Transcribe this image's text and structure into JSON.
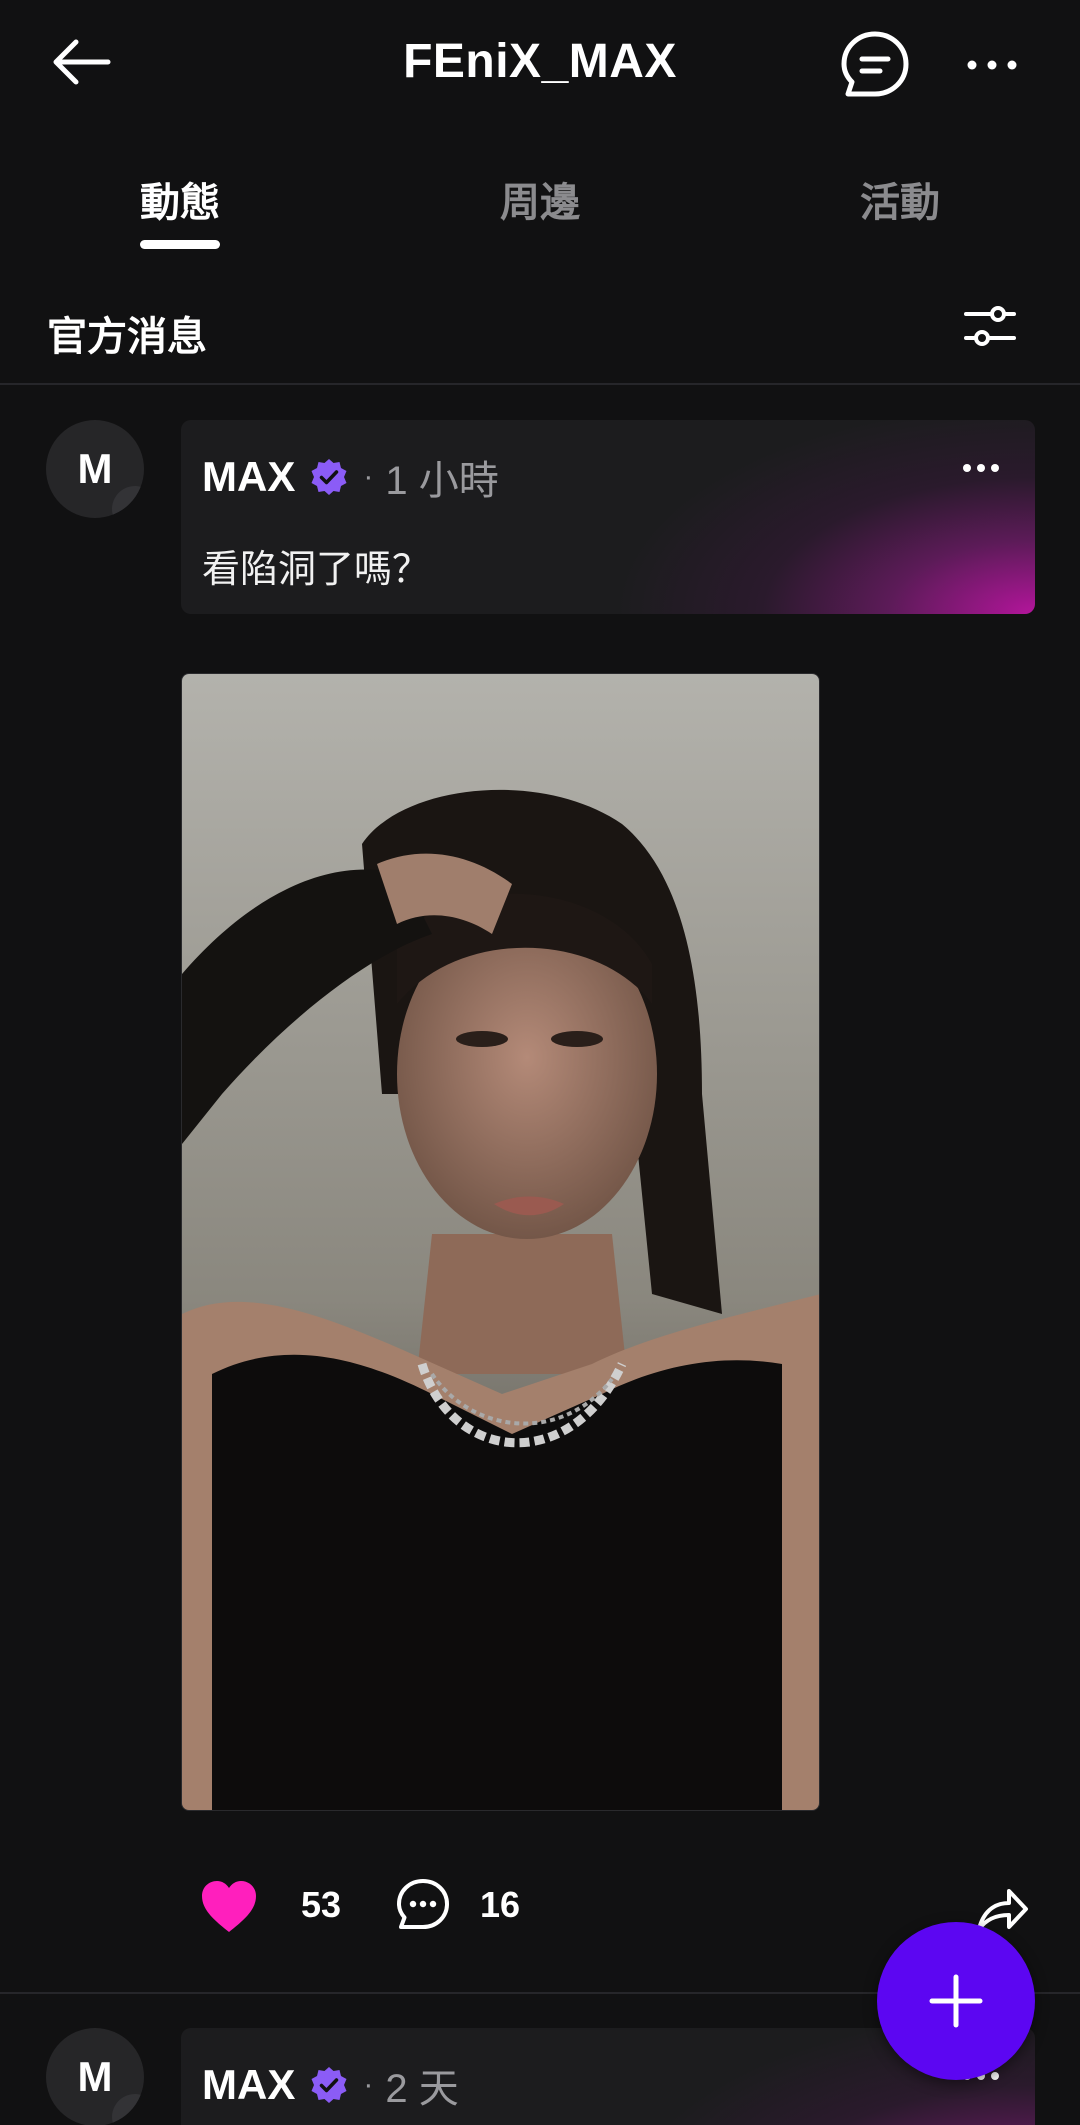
{
  "header": {
    "title": "FEniX_MAX",
    "back_icon": "back-arrow-icon",
    "chat_icon": "chat-bubble-icon",
    "more_icon": "more-horizontal-icon"
  },
  "tabs": [
    {
      "label": "動態",
      "active": true
    },
    {
      "label": "周邊",
      "active": false
    },
    {
      "label": "活動",
      "active": false
    }
  ],
  "section": {
    "title": "官方消息",
    "filter_icon": "sliders-icon"
  },
  "posts": [
    {
      "avatar_letter": "M",
      "author": "MAX",
      "verified": true,
      "separator": "·",
      "time": "1 小時",
      "text": "看陷洞了嗎？",
      "likes": "53",
      "comments": "16",
      "liked": true
    },
    {
      "avatar_letter": "M",
      "author": "MAX",
      "verified": true,
      "separator": "·",
      "time": "2 天"
    }
  ],
  "fab": {
    "icon": "plus-icon"
  },
  "colors": {
    "background": "#111112",
    "accent_like": "#ff1fbd",
    "verified_badge": "#8b5cf6",
    "fab": "#5c06f2",
    "card_gradient_end": "#b3159b"
  }
}
